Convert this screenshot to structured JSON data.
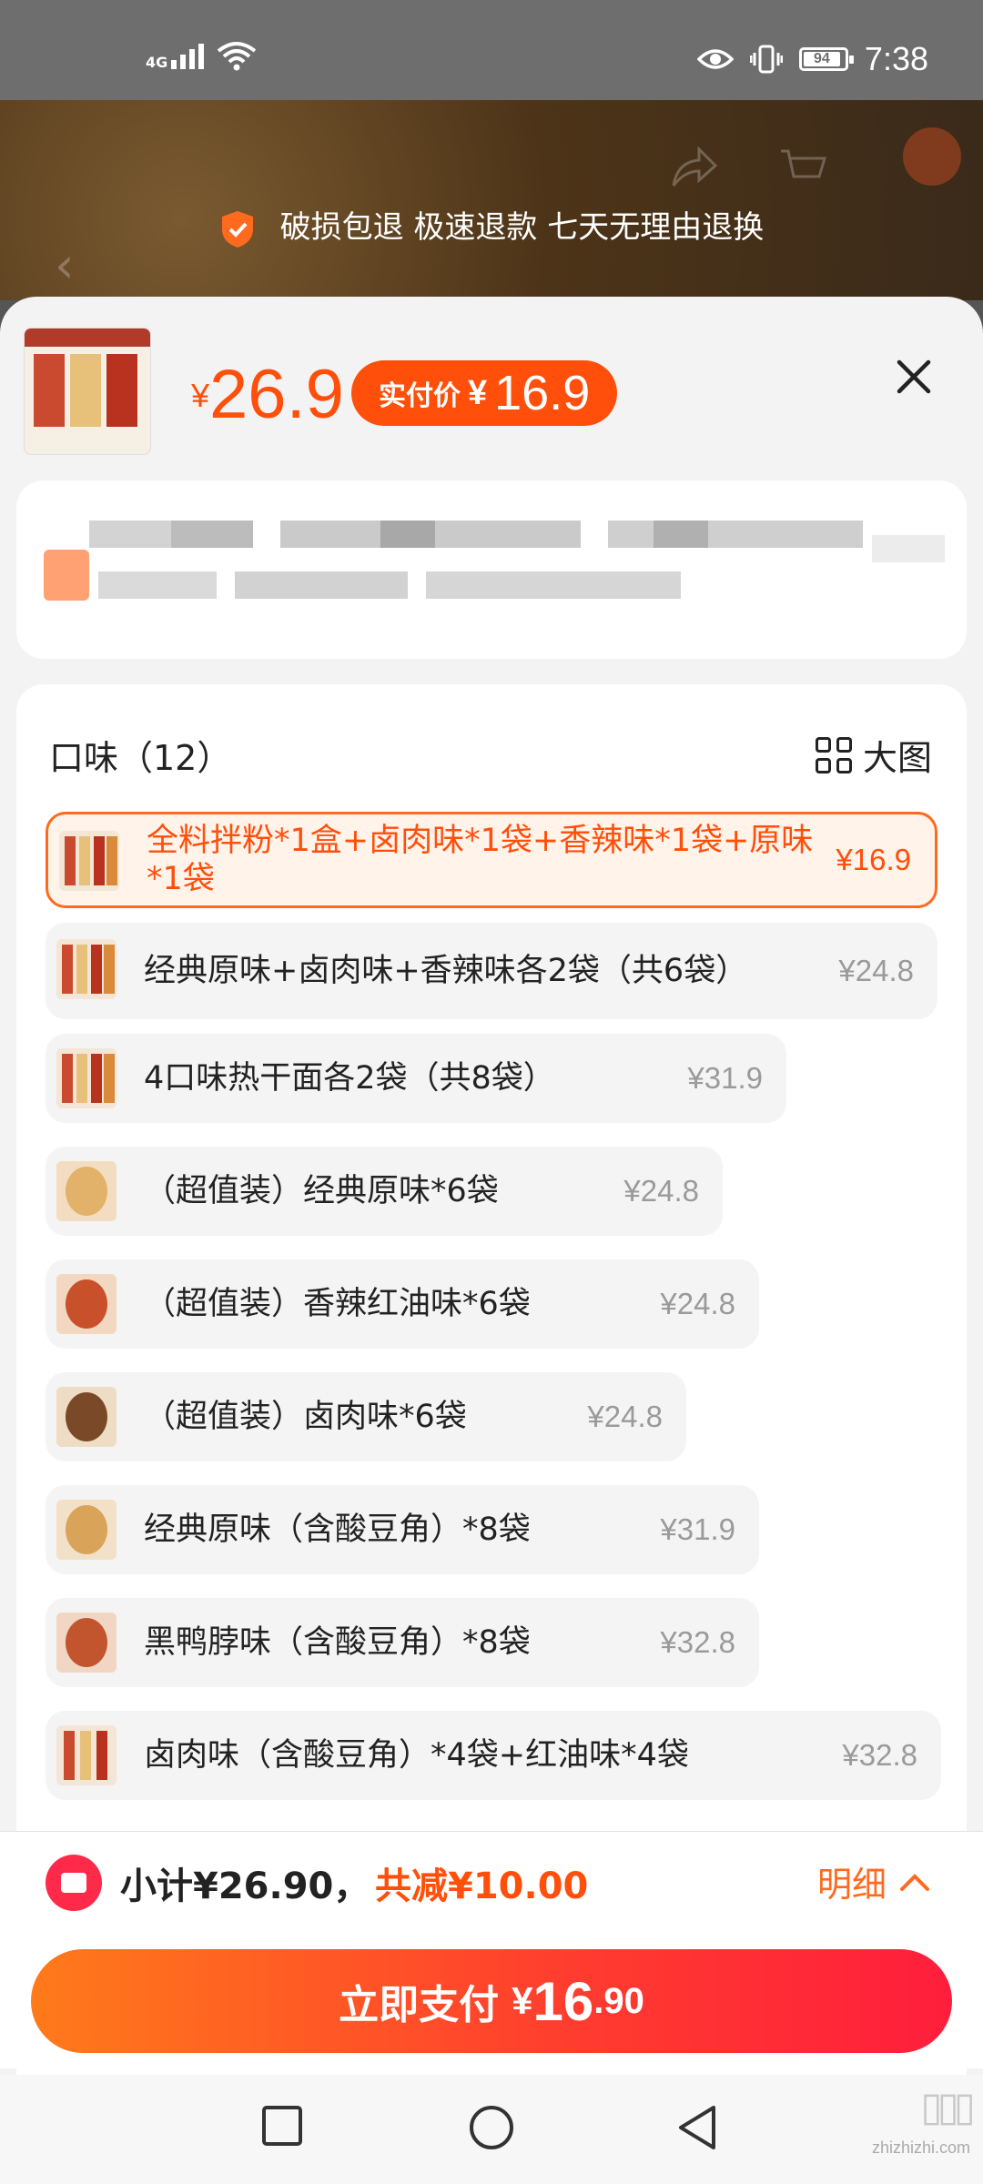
{
  "status_bar": {
    "network": "4G",
    "battery": "94",
    "time": "7:38"
  },
  "guarantee": {
    "text": "破损包退 极速退款 七天无理由退换"
  },
  "header": {
    "currency": "¥",
    "price": "26.9",
    "pay_label": "实付价",
    "pay_currency": "¥",
    "pay_price": "16.9"
  },
  "options": {
    "title": "口味（12）",
    "big_image_label": "大图",
    "items": [
      {
        "name": "全料拌粉*1盒+卤肉味*1袋+香辣味*1袋+原味*1袋",
        "price": "¥16.9",
        "selected": true
      },
      {
        "name": "经典原味+卤肉味+香辣味各2袋（共6袋）",
        "price": "¥24.8",
        "selected": false
      },
      {
        "name": "4口味热干面各2袋（共8袋）",
        "price": "¥31.9",
        "selected": false
      },
      {
        "name": "（超值装）经典原味*6袋",
        "price": "¥24.8",
        "selected": false
      },
      {
        "name": "（超值装）香辣红油味*6袋",
        "price": "¥24.8",
        "selected": false
      },
      {
        "name": "（超值装）卤肉味*6袋",
        "price": "¥24.8",
        "selected": false
      },
      {
        "name": "经典原味（含酸豆角）*8袋",
        "price": "¥31.9",
        "selected": false
      },
      {
        "name": "黑鸭脖味（含酸豆角）*8袋",
        "price": "¥32.8",
        "selected": false
      },
      {
        "name": "卤肉味（含酸豆角）*4袋+红油味*4袋",
        "price": "¥32.8",
        "selected": false
      }
    ]
  },
  "footer": {
    "subtotal": "小计¥26.90，",
    "reduce": "共减¥10.00",
    "detail": "明细",
    "pay_label": "立即支付",
    "pay_currency": "¥",
    "pay_int": "16",
    "pay_dec": ".90"
  },
  "watermark": {
    "site": "zhizhizhi.com"
  },
  "colors": {
    "accent": "#ff4f0a",
    "pay_gradient_start": "#ff7a1a",
    "pay_gradient_end": "#ff1e3c"
  }
}
